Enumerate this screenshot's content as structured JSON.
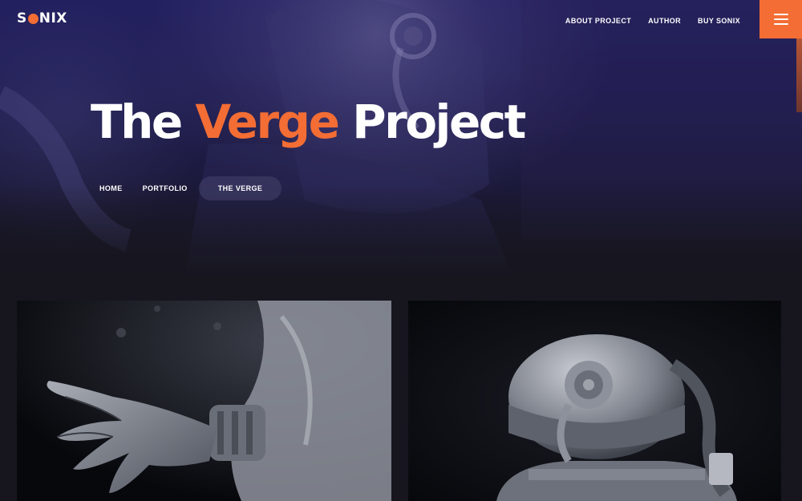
{
  "header": {
    "logo": {
      "before": "S",
      "after": "NIX"
    },
    "nav": [
      {
        "label": "ABOUT PROJECT"
      },
      {
        "label": "AUTHOR"
      },
      {
        "label": "BUY SONIX"
      }
    ],
    "menu_icon": "hamburger-icon"
  },
  "hero": {
    "title": {
      "part1": "The ",
      "highlight": "Verge",
      "part2": " Project"
    },
    "breadcrumb": {
      "home": "HOME",
      "portfolio": "PORTFOLIO",
      "current": "THE VERGE"
    }
  },
  "gallery": {
    "items": [
      {
        "subject": "astronaut-glove-image"
      },
      {
        "subject": "astronaut-helmet-image"
      }
    ]
  },
  "colors": {
    "accent": "#f36d34",
    "hero_bg": "#221f5a",
    "page_bg": "#17161f"
  }
}
